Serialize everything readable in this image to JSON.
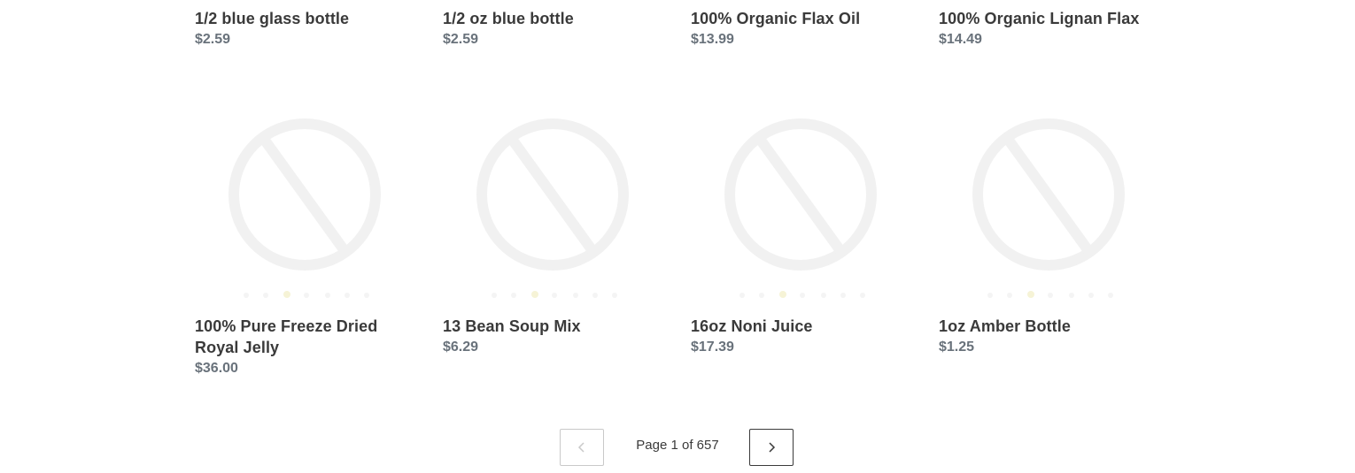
{
  "products": [
    {
      "title": "1/2 blue glass bottle",
      "price": "$2.59"
    },
    {
      "title": "1/2 oz blue bottle",
      "price": "$2.59"
    },
    {
      "title": "100% Organic Flax Oil",
      "price": "$13.99"
    },
    {
      "title": "100% Organic Lignan Flax",
      "price": "$14.49"
    },
    {
      "title": "100% Pure Freeze Dried Royal Jelly",
      "price": "$36.00"
    },
    {
      "title": "13 Bean Soup Mix",
      "price": "$6.29"
    },
    {
      "title": "16oz Noni Juice",
      "price": "$17.39"
    },
    {
      "title": "1oz Amber Bottle",
      "price": "$1.25"
    }
  ],
  "placeholder_icon": "no-image-icon",
  "pagination": {
    "label": "Page 1 of 657",
    "prev_icon": "chevron-left-icon",
    "next_icon": "chevron-right-icon"
  },
  "colors": {
    "title": "#3a3a3a",
    "price": "#69727b",
    "placeholder": "#f1f1f1"
  }
}
